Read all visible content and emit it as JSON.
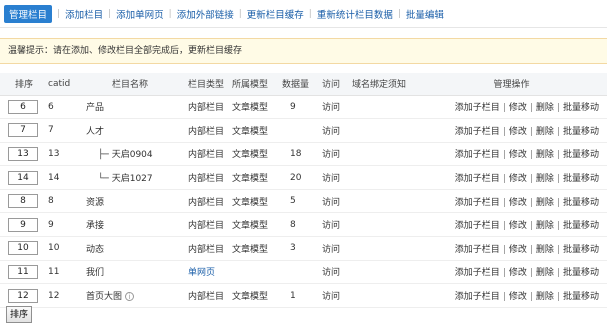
{
  "toolbar": {
    "items": [
      {
        "label": "管理栏目",
        "active": true
      },
      {
        "label": "添加栏目",
        "active": false
      },
      {
        "label": "添加单网页",
        "active": false
      },
      {
        "label": "添加外部链接",
        "active": false
      },
      {
        "label": "更新栏目缓存",
        "active": false
      },
      {
        "label": "重新统计栏目数据",
        "active": false
      },
      {
        "label": "批量编辑",
        "active": false
      }
    ],
    "separator": "|"
  },
  "notice": "温馨提示：请在添加、修改栏目全部完成后，更新栏目缓存",
  "table": {
    "headers": {
      "sort": "排序",
      "catid": "catid",
      "name": "栏目名称",
      "type": "栏目类型",
      "model": "所属模型",
      "count": "数据量",
      "visit": "访问",
      "domain": "域名绑定须知",
      "ops": "管理操作"
    },
    "rows": [
      {
        "sort": "6",
        "catid": "6",
        "tree": "",
        "name": "产品",
        "type": "内部栏目",
        "type_link": false,
        "model": "文章模型",
        "count": "9",
        "visit": "访问"
      },
      {
        "sort": "7",
        "catid": "7",
        "tree": "",
        "name": "人才",
        "type": "内部栏目",
        "type_link": false,
        "model": "文章模型",
        "count": "",
        "visit": "访问"
      },
      {
        "sort": "13",
        "catid": "13",
        "tree": "├─",
        "name": "天启0904",
        "type": "内部栏目",
        "type_link": false,
        "model": "文章模型",
        "count": "18",
        "visit": "访问"
      },
      {
        "sort": "14",
        "catid": "14",
        "tree": "└─",
        "name": "天启1027",
        "type": "内部栏目",
        "type_link": false,
        "model": "文章模型",
        "count": "20",
        "visit": "访问"
      },
      {
        "sort": "8",
        "catid": "8",
        "tree": "",
        "name": "资源",
        "type": "内部栏目",
        "type_link": false,
        "model": "文章模型",
        "count": "5",
        "visit": "访问"
      },
      {
        "sort": "9",
        "catid": "9",
        "tree": "",
        "name": "承接",
        "type": "内部栏目",
        "type_link": false,
        "model": "文章模型",
        "count": "8",
        "visit": "访问"
      },
      {
        "sort": "10",
        "catid": "10",
        "tree": "",
        "name": "动态",
        "type": "内部栏目",
        "type_link": false,
        "model": "文章模型",
        "count": "3",
        "visit": "访问"
      },
      {
        "sort": "11",
        "catid": "11",
        "tree": "",
        "name": "我们",
        "type": "单网页",
        "type_link": true,
        "model": "",
        "count": "",
        "visit": "访问"
      },
      {
        "sort": "12",
        "catid": "12",
        "tree": "",
        "name": "首页大图",
        "type": "内部栏目",
        "type_link": false,
        "model": "文章模型",
        "count": "1",
        "visit": "访问",
        "info_icon": true
      }
    ],
    "ops": [
      "添加子栏目",
      "修改",
      "删除",
      "批量移动"
    ],
    "ops_separator": "|"
  },
  "info_icon_glyph": "i",
  "sort_button": "排序"
}
